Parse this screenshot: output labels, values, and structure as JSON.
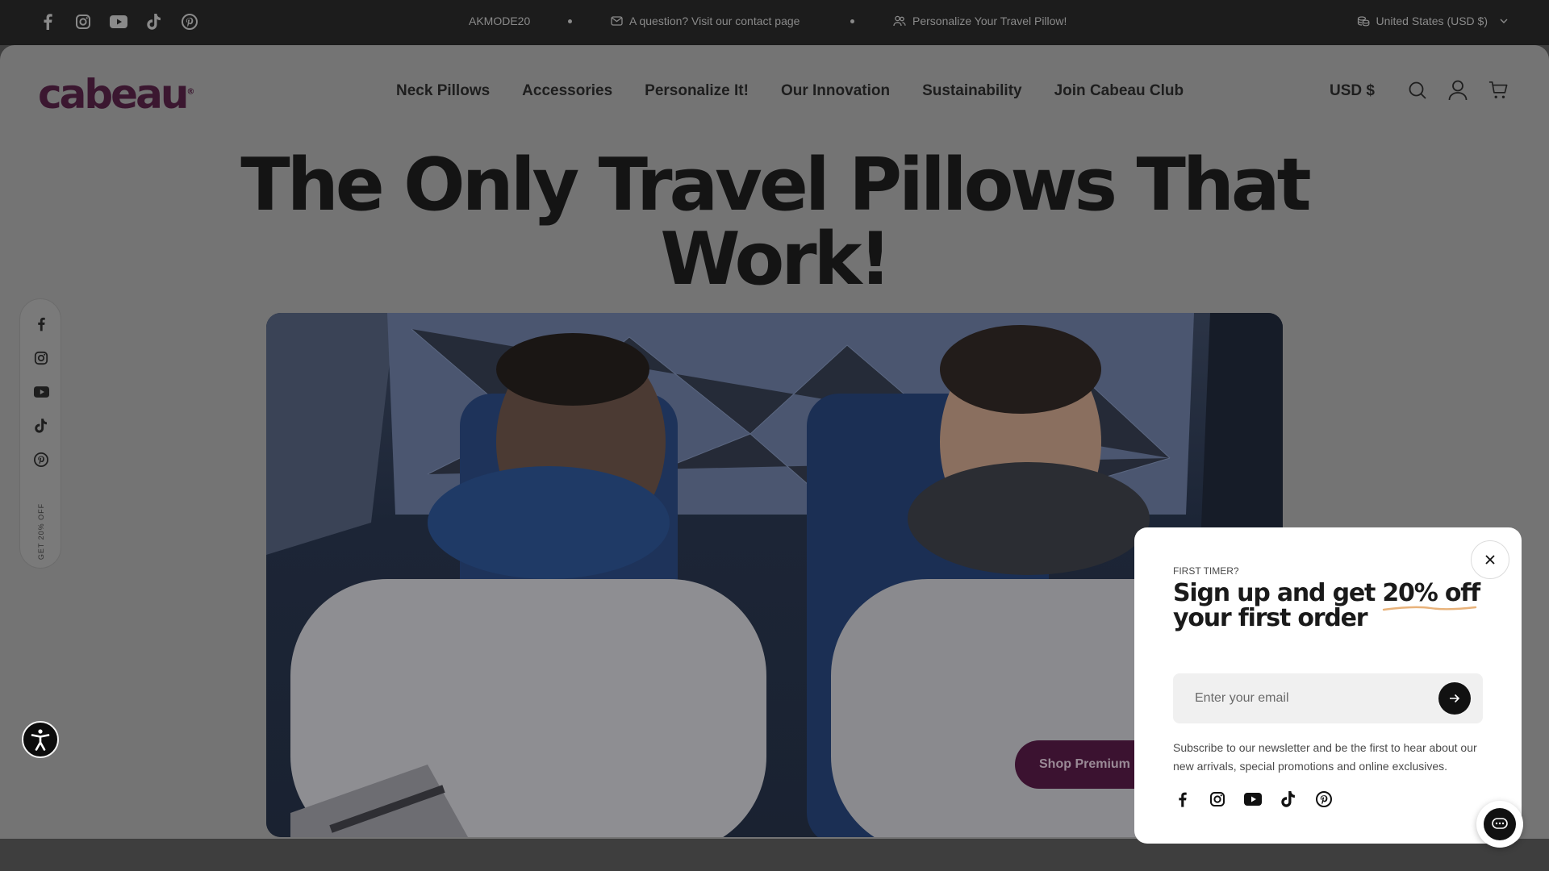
{
  "topbar": {
    "social_icons": [
      "facebook-icon",
      "instagram-icon",
      "youtube-icon",
      "tiktok-icon",
      "pinterest-icon"
    ],
    "promo_code": "AKMODE20",
    "contact_text": "A question? Visit our contact page",
    "personalize_text": "Personalize Your Travel Pillow!",
    "locale": "United States (USD $)"
  },
  "header": {
    "logo": "cabeau",
    "nav": [
      "Neck Pillows",
      "Accessories",
      "Personalize It!",
      "Our Innovation",
      "Sustainability",
      "Join Cabeau Club"
    ],
    "currency": "USD $",
    "icons": [
      "search-icon",
      "account-icon",
      "cart-icon"
    ]
  },
  "hero": {
    "title_line1": "The Only Travel Pillows That",
    "title_line2": "Work!",
    "cta_label": "Shop Premium P"
  },
  "float_social": {
    "icons": [
      "facebook-icon",
      "instagram-icon",
      "youtube-icon",
      "tiktok-icon",
      "pinterest-icon"
    ],
    "promo_tab": "GET 20% OFF"
  },
  "popup": {
    "eyebrow": "FIRST TIMER?",
    "headline_pre": "Sign up and get ",
    "headline_highlight": "20% off",
    "headline_post": " your first order",
    "email_placeholder": "Enter your email",
    "description": "Subscribe to our newsletter and be the first to hear about our new arrivals, special promotions and online exclusives.",
    "social_icons": [
      "facebook-icon",
      "instagram-icon",
      "youtube-icon",
      "tiktok-icon",
      "pinterest-icon"
    ]
  },
  "colors": {
    "brand": "#3b1730",
    "topbar_bg": "#1c1c1c",
    "highlight_underline": "#e8b27a"
  }
}
